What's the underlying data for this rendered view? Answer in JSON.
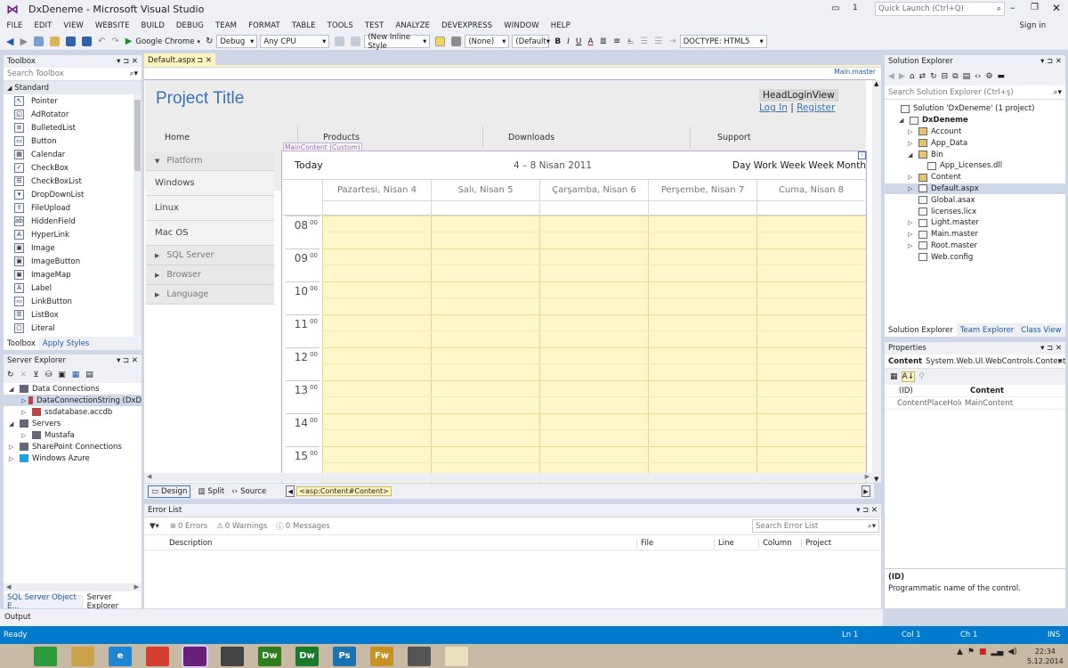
{
  "window": {
    "title": "DxDeneme - Microsoft Visual Studio",
    "notif_count": "1",
    "quick_launch": "Quick Launch (Ctrl+Q)",
    "sign_in": "Sign in"
  },
  "menu": [
    "FILE",
    "EDIT",
    "VIEW",
    "WEBSITE",
    "BUILD",
    "DEBUG",
    "TEAM",
    "FORMAT",
    "TABLE",
    "TOOLS",
    "TEST",
    "ANALYZE",
    "DEVEXPRESS",
    "WINDOW",
    "HELP"
  ],
  "toolbar": {
    "browser": "Google Chrome",
    "config": "Debug",
    "platform": "Any CPU",
    "style": "(New Inline Style",
    "target": "(None)",
    "font": "(Default",
    "bold": "B",
    "italic": "I",
    "underline": "U",
    "font_color": "A",
    "doctype": "DOCTYPE: HTML5"
  },
  "toolbox": {
    "title": "Toolbox",
    "search": "Search Toolbox",
    "group": "Standard",
    "items": [
      {
        "label": "Pointer",
        "glyph": "↖"
      },
      {
        "label": "AdRotator",
        "glyph": "◱"
      },
      {
        "label": "BulletedList",
        "glyph": "≡"
      },
      {
        "label": "Button",
        "glyph": "▭"
      },
      {
        "label": "Calendar",
        "glyph": "▦"
      },
      {
        "label": "CheckBox",
        "glyph": "✓"
      },
      {
        "label": "CheckBoxList",
        "glyph": "☰"
      },
      {
        "label": "DropDownList",
        "glyph": "▾"
      },
      {
        "label": "FileUpload",
        "glyph": "⇪"
      },
      {
        "label": "HiddenField",
        "glyph": "ab"
      },
      {
        "label": "HyperLink",
        "glyph": "A"
      },
      {
        "label": "Image",
        "glyph": "▣"
      },
      {
        "label": "ImageButton",
        "glyph": "▣"
      },
      {
        "label": "ImageMap",
        "glyph": "▣"
      },
      {
        "label": "Label",
        "glyph": "A"
      },
      {
        "label": "LinkButton",
        "glyph": "▭"
      },
      {
        "label": "ListBox",
        "glyph": "☰"
      },
      {
        "label": "Literal",
        "glyph": "▢"
      }
    ],
    "tabs": [
      "Toolbox",
      "Apply Styles"
    ]
  },
  "server_explorer": {
    "title": "Server Explorer",
    "items": [
      {
        "label": "Data Connections",
        "indent": 0,
        "arrow": "◢"
      },
      {
        "label": "DataConnectionString (DxD",
        "indent": 1,
        "arrow": "▷"
      },
      {
        "label": "ssdatabase.accdb",
        "indent": 1,
        "arrow": "▷"
      },
      {
        "label": "Servers",
        "indent": 0,
        "arrow": "◢"
      },
      {
        "label": "Mustafa",
        "indent": 1,
        "arrow": "▷"
      },
      {
        "label": "SharePoint Connections",
        "indent": 0,
        "arrow": "▷"
      },
      {
        "label": "Windows Azure",
        "indent": 0,
        "arrow": "▷"
      }
    ],
    "tabs": [
      "SQL Server Object E...",
      "Server Explorer"
    ]
  },
  "output": {
    "title": "Output"
  },
  "editor": {
    "tab": "Default.aspx",
    "master": "Main.master",
    "content_label": "MainContent (Custom)",
    "project_title": "Project Title",
    "head_login": "HeadLoginView",
    "login": "Log In",
    "register": "Register",
    "separator": "|",
    "nav": [
      "Home",
      "Products",
      "Downloads",
      "Support"
    ],
    "sidebar": [
      {
        "label": "Platform",
        "group": true,
        "arrow": "▼"
      },
      {
        "label": "Windows",
        "group": false
      },
      {
        "label": "Linux",
        "group": false
      },
      {
        "label": "Mac OS",
        "group": false
      },
      {
        "label": "SQL Server",
        "group": true,
        "arrow": "▶"
      },
      {
        "label": "Browser",
        "group": true,
        "arrow": "▶"
      },
      {
        "label": "Language",
        "group": true,
        "arrow": "▶"
      }
    ],
    "scheduler": {
      "today": "Today",
      "range": "4 – 8 Nisan 2011",
      "views": [
        "Day",
        "Work Week",
        "Week",
        "Month"
      ],
      "days": [
        "Pazartesi, Nisan 4",
        "Salı, Nisan 5",
        "Çarşamba, Nisan 6",
        "Perşembe, Nisan 7",
        "Cuma, Nisan 8"
      ],
      "hours": [
        "08",
        "09",
        "10",
        "11",
        "12",
        "13",
        "14",
        "15"
      ],
      "minutes": "00"
    },
    "view_tabs": [
      "Design",
      "Split",
      "Source"
    ],
    "breadcrumb": "<asp:Content#Content>"
  },
  "error_list": {
    "title": "Error List",
    "errors": "0 Errors",
    "warnings": "0 Warnings",
    "messages": "0 Messages",
    "search": "Search Error List",
    "columns": [
      "Description",
      "File",
      "Line",
      "Column",
      "Project"
    ]
  },
  "solution_explorer": {
    "title": "Solution Explorer",
    "search": "Search Solution Explorer (Ctrl+ş)",
    "items": [
      {
        "label": "Solution 'DxDeneme' (1 project)",
        "indent": 0,
        "arrow": ""
      },
      {
        "label": "DxDeneme",
        "indent": 1,
        "arrow": "◢"
      },
      {
        "label": "Account",
        "indent": 2,
        "arrow": "▷"
      },
      {
        "label": "App_Data",
        "indent": 2,
        "arrow": "▷"
      },
      {
        "label": "Bin",
        "indent": 2,
        "arrow": "◢"
      },
      {
        "label": "App_Licenses.dll",
        "indent": 3,
        "arrow": ""
      },
      {
        "label": "Content",
        "indent": 2,
        "arrow": "▷"
      },
      {
        "label": "Default.aspx",
        "indent": 2,
        "arrow": "▷"
      },
      {
        "label": "Global.asax",
        "indent": 2,
        "arrow": ""
      },
      {
        "label": "licenses.licx",
        "indent": 2,
        "arrow": ""
      },
      {
        "label": "Light.master",
        "indent": 2,
        "arrow": "▷"
      },
      {
        "label": "Main.master",
        "indent": 2,
        "arrow": "▷"
      },
      {
        "label": "Root.master",
        "indent": 2,
        "arrow": "▷"
      },
      {
        "label": "Web.config",
        "indent": 2,
        "arrow": ""
      }
    ],
    "tabs": [
      "Solution Explorer",
      "Team Explorer",
      "Class View"
    ]
  },
  "properties": {
    "title": "Properties",
    "object": "Content",
    "object_type": "System.Web.UI.WebControls.Content",
    "prop_name": "(ID)",
    "prop_value": "Content",
    "row2_name": "ContentPlaceHolderID",
    "row2_value": "MainContent",
    "desc_title": "(ID)",
    "desc_text": "Programmatic name of the control."
  },
  "status": {
    "text": "Ready",
    "ln": "Ln 1",
    "col": "Col 1",
    "ch": "Ch 1",
    "ins": "INS"
  },
  "taskbar": {
    "time": "22:34",
    "date": "5.12.2014",
    "apps": [
      {
        "label": "",
        "color": "#2d9a3e"
      },
      {
        "label": "",
        "color": "#c9a24a"
      },
      {
        "label": "e",
        "color": "#1f86d4"
      },
      {
        "label": "",
        "color": "#d23f31"
      },
      {
        "label": "",
        "color": "#68217a"
      },
      {
        "label": "",
        "color": "#444444"
      },
      {
        "label": "Dw",
        "color": "#2f7d1c"
      },
      {
        "label": "Dw",
        "color": "#1b7a2a"
      },
      {
        "label": "Ps",
        "color": "#1c73b4"
      },
      {
        "label": "Fw",
        "color": "#c69222"
      },
      {
        "label": "",
        "color": "#555555"
      },
      {
        "label": "",
        "color": "#e8e0c0"
      }
    ]
  },
  "colors": {
    "accent": "#007acc",
    "vs_purple": "#68217a",
    "sched_bg": "#fff7c9",
    "tab_active": "#fdf4bf"
  }
}
